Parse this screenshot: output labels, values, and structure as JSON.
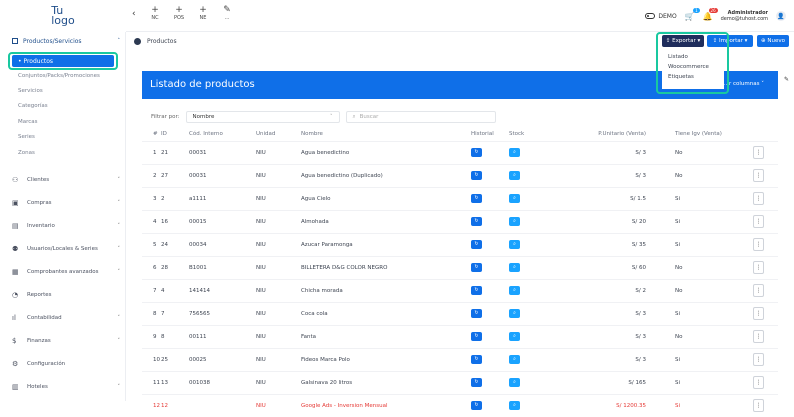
{
  "logo": {
    "line1": "Tu",
    "line2": "logo"
  },
  "topbar": {
    "shortcuts": [
      {
        "label": "NC"
      },
      {
        "label": "POS"
      },
      {
        "label": "NE"
      },
      {
        "label": "..."
      }
    ],
    "demo_label": "DEMO",
    "cart_badge": "1",
    "bell_badge": "26",
    "user_name": "Administrador",
    "user_email": "demo@tuhost.com"
  },
  "sidebar": {
    "header": "Productos/Servicios",
    "active": "• Productos",
    "sub_items": [
      "Conjuntos/Packs/Promociones",
      "Servicios",
      "Categorías",
      "Marcas",
      "Series",
      "Zonas"
    ],
    "main_items": [
      {
        "label": "Clientes",
        "icon": "users-icon",
        "chev": true
      },
      {
        "label": "Compras",
        "icon": "shopping-bag-icon",
        "chev": true
      },
      {
        "label": "Inventario",
        "icon": "inventory-icon",
        "chev": true
      },
      {
        "label": "Usuarios/Locales & Series",
        "icon": "user-group-icon",
        "chev": true
      },
      {
        "label": "Comprobantes avanzados",
        "icon": "document-icon",
        "chev": true
      },
      {
        "label": "Reportes",
        "icon": "chart-pie-icon",
        "chev": false
      },
      {
        "label": "Contabilidad",
        "icon": "bar-chart-icon",
        "chev": true
      },
      {
        "label": "Finanzas",
        "icon": "dollar-icon",
        "chev": true
      },
      {
        "label": "Configuración",
        "icon": "gear-icon",
        "chev": false
      },
      {
        "label": "Hoteles",
        "icon": "building-icon",
        "chev": true
      }
    ]
  },
  "breadcrumb": "Productos",
  "buttons": {
    "exportar": "Exportar",
    "importar": "Importar",
    "nuevo": "Nuevo"
  },
  "export_menu": [
    "Listado",
    "Woocommerce",
    "Etiquetas"
  ],
  "card": {
    "title": "Listado de productos",
    "columns_label": "...r columnas"
  },
  "filter": {
    "label": "Filtrar por:",
    "select_value": "Nombre",
    "search_placeholder": "Buscar"
  },
  "table": {
    "headers": [
      "#",
      "ID",
      "Cód. Interno",
      "Unidad",
      "Nombre",
      "Historial",
      "Stock",
      "P.Unitario (Venta)",
      "Tiene Igv (Venta)",
      ""
    ],
    "rows": [
      {
        "n": "1",
        "id": "21",
        "code": "00031",
        "unit": "NIU",
        "name": "Agua benedictino",
        "price": "S/ 3",
        "igv": "No",
        "red": false
      },
      {
        "n": "2",
        "id": "27",
        "code": "00031",
        "unit": "NIU",
        "name": "Agua benedictino (Duplicado)",
        "price": "S/ 3",
        "igv": "No",
        "red": false
      },
      {
        "n": "3",
        "id": "2",
        "code": "a1111",
        "unit": "NIU",
        "name": "Agua Cielo",
        "price": "S/ 1.5",
        "igv": "Si",
        "red": false
      },
      {
        "n": "4",
        "id": "16",
        "code": "00015",
        "unit": "NIU",
        "name": "Almohada",
        "price": "S/ 20",
        "igv": "Si",
        "red": false
      },
      {
        "n": "5",
        "id": "24",
        "code": "00034",
        "unit": "NIU",
        "name": "Azucar Paramonga",
        "price": "S/ 35",
        "igv": "Si",
        "red": false
      },
      {
        "n": "6",
        "id": "28",
        "code": "B1001",
        "unit": "NIU",
        "name": "BILLETERA D&G COLOR NEGRO",
        "price": "S/ 60",
        "igv": "No",
        "red": false
      },
      {
        "n": "7",
        "id": "4",
        "code": "141414",
        "unit": "NIU",
        "name": "Chicha morada",
        "price": "S/ 2",
        "igv": "No",
        "red": false
      },
      {
        "n": "8",
        "id": "7",
        "code": "756565",
        "unit": "NIU",
        "name": "Coca cola",
        "price": "S/ 3",
        "igv": "Si",
        "red": false
      },
      {
        "n": "9",
        "id": "8",
        "code": "00111",
        "unit": "NIU",
        "name": "Fanta",
        "price": "S/ 3",
        "igv": "No",
        "red": false
      },
      {
        "n": "10",
        "id": "25",
        "code": "00025",
        "unit": "NIU",
        "name": "Fideos Marca Polo",
        "price": "S/ 3",
        "igv": "Si",
        "red": false
      },
      {
        "n": "11",
        "id": "13",
        "code": "001038",
        "unit": "NIU",
        "name": "Galsinava 20 litros",
        "price": "S/ 165",
        "igv": "Si",
        "red": false
      },
      {
        "n": "12",
        "id": "12",
        "code": "",
        "unit": "NIU",
        "name": "Google Ads - Inversion Mensual",
        "price": "S/ 1200.35",
        "igv": "Si",
        "red": true
      }
    ]
  }
}
